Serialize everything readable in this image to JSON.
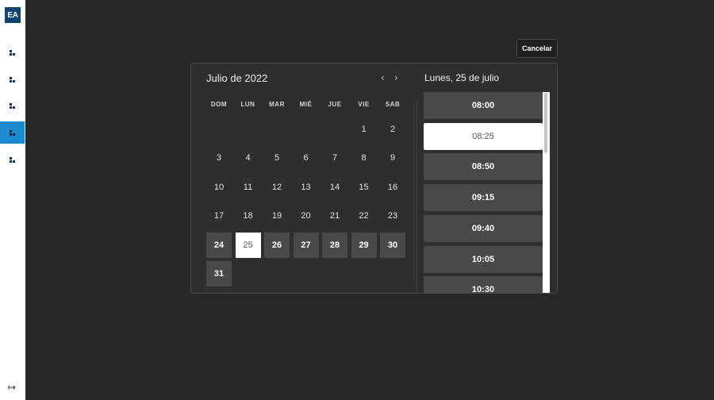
{
  "sidebar": {
    "logo_text": "EA",
    "items": [
      {
        "icon": "grid-icon",
        "active": false
      },
      {
        "icon": "grid-icon",
        "active": false
      },
      {
        "icon": "grid-icon",
        "active": false
      },
      {
        "icon": "grid-icon",
        "active": true
      },
      {
        "icon": "grid-icon",
        "active": false
      }
    ],
    "exit_icon": "logout-icon",
    "exit_glyph": "↦"
  },
  "actions": {
    "cancel_label": "Cancelar"
  },
  "calendar": {
    "month_title": "Julio de 2022",
    "prev_glyph": "‹",
    "next_glyph": "›",
    "weekdays": [
      "DOM",
      "LUN",
      "MAR",
      "MIÉ",
      "JUE",
      "VIE",
      "SAB"
    ],
    "first_weekday_index": 5,
    "days": [
      {
        "label": "1",
        "state": "disabled"
      },
      {
        "label": "2",
        "state": "disabled"
      },
      {
        "label": "3",
        "state": "disabled"
      },
      {
        "label": "4",
        "state": "disabled"
      },
      {
        "label": "5",
        "state": "disabled"
      },
      {
        "label": "6",
        "state": "disabled"
      },
      {
        "label": "7",
        "state": "disabled"
      },
      {
        "label": "8",
        "state": "disabled"
      },
      {
        "label": "9",
        "state": "disabled"
      },
      {
        "label": "10",
        "state": "disabled"
      },
      {
        "label": "11",
        "state": "disabled"
      },
      {
        "label": "12",
        "state": "disabled"
      },
      {
        "label": "13",
        "state": "disabled"
      },
      {
        "label": "14",
        "state": "disabled"
      },
      {
        "label": "15",
        "state": "disabled"
      },
      {
        "label": "16",
        "state": "disabled"
      },
      {
        "label": "17",
        "state": "disabled"
      },
      {
        "label": "18",
        "state": "disabled"
      },
      {
        "label": "19",
        "state": "disabled"
      },
      {
        "label": "20",
        "state": "disabled"
      },
      {
        "label": "21",
        "state": "disabled"
      },
      {
        "label": "22",
        "state": "disabled"
      },
      {
        "label": "23",
        "state": "disabled"
      },
      {
        "label": "24",
        "state": "available"
      },
      {
        "label": "25",
        "state": "selected"
      },
      {
        "label": "26",
        "state": "available"
      },
      {
        "label": "27",
        "state": "available"
      },
      {
        "label": "28",
        "state": "available"
      },
      {
        "label": "29",
        "state": "available"
      },
      {
        "label": "30",
        "state": "available"
      },
      {
        "label": "31",
        "state": "available"
      }
    ]
  },
  "times": {
    "date_title": "Lunes, 25 de julio",
    "slots": [
      {
        "label": "08:00",
        "selected": false
      },
      {
        "label": "08:25",
        "selected": true
      },
      {
        "label": "08:50",
        "selected": false
      },
      {
        "label": "09:15",
        "selected": false
      },
      {
        "label": "09:40",
        "selected": false
      },
      {
        "label": "10:05",
        "selected": false
      },
      {
        "label": "10:30",
        "selected": false
      }
    ]
  },
  "colors": {
    "background": "#272727",
    "panel": "#2e2e2e",
    "accent": "#1b8ad1",
    "available": "#494949",
    "selected": "#ffffff"
  }
}
